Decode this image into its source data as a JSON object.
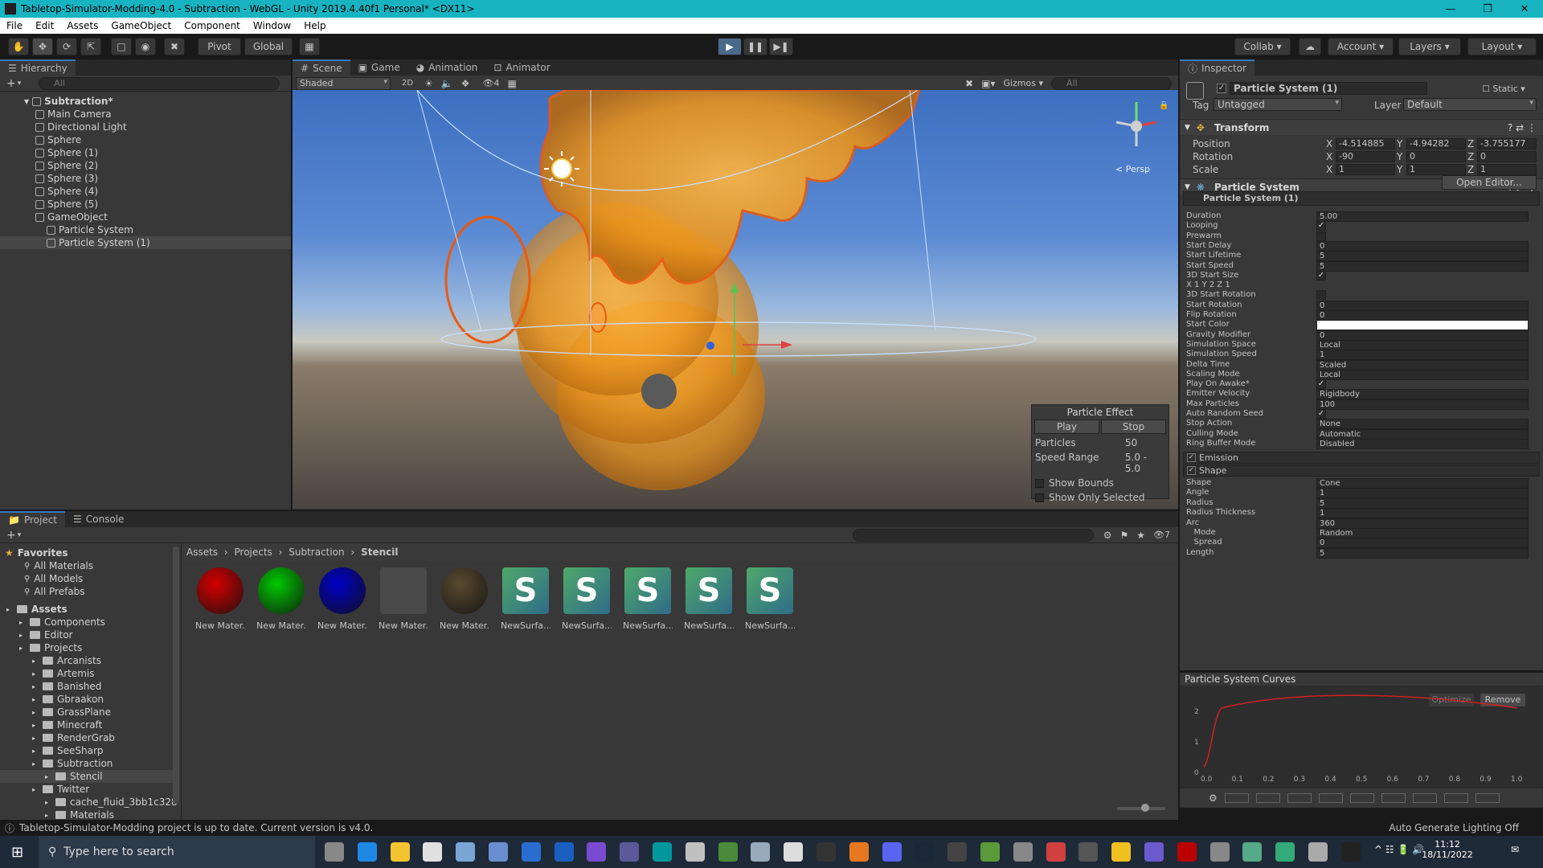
{
  "window": {
    "title": "Tabletop-Simulator-Modding-4.0 - Subtraction - WebGL - Unity 2019.4.40f1 Personal* <DX11>"
  },
  "menu": [
    "File",
    "Edit",
    "Assets",
    "GameObject",
    "Component",
    "Window",
    "Help"
  ],
  "toolbar": {
    "pivot": "Pivot",
    "global": "Global",
    "collab": "Collab",
    "account": "Account",
    "layers": "Layers",
    "layout": "Layout"
  },
  "hierarchy": {
    "tab": "Hierarchy",
    "search_placeholder": "All",
    "items": [
      {
        "label": "Subtraction*",
        "indent": 0
      },
      {
        "label": "Main Camera",
        "indent": 1
      },
      {
        "label": "Directional Light",
        "indent": 1
      },
      {
        "label": "Sphere",
        "indent": 1
      },
      {
        "label": "Sphere (1)",
        "indent": 1
      },
      {
        "label": "Sphere (2)",
        "indent": 1
      },
      {
        "label": "Sphere (3)",
        "indent": 1
      },
      {
        "label": "Sphere (4)",
        "indent": 1
      },
      {
        "label": "Sphere (5)",
        "indent": 1
      },
      {
        "label": "GameObject",
        "indent": 1
      },
      {
        "label": "Particle System",
        "indent": 2
      },
      {
        "label": "Particle System (1)",
        "indent": 2
      }
    ]
  },
  "scene": {
    "tabs": [
      "Scene",
      "Game",
      "Animation",
      "Animator"
    ],
    "shading": "Shaded",
    "mode2d": "2D",
    "gizmos": "Gizmos",
    "search_placeholder": "All",
    "layer_count": "4",
    "persp": "< Persp",
    "particle_effect": {
      "title": "Particle Effect",
      "play": "Play",
      "stop": "Stop",
      "particles_label": "Particles",
      "particles_value": "50",
      "speed_label": "Speed Range",
      "speed_value": "5.0 - 5.0",
      "show_bounds": "Show Bounds",
      "show_selected": "Show Only Selected"
    }
  },
  "inspector": {
    "tab": "Inspector",
    "object_name": "Particle System (1)",
    "static_label": "Static",
    "tag_label": "Tag",
    "tag_value": "Untagged",
    "layer_label": "Layer",
    "layer_value": "Default",
    "transform": {
      "title": "Transform",
      "rows": [
        {
          "label": "Position",
          "x": "-4.514885",
          "y": "-4.94282",
          "z": "-3.755177"
        },
        {
          "label": "Rotation",
          "x": "-90",
          "y": "0",
          "z": "0"
        },
        {
          "label": "Scale",
          "x": "1",
          "y": "1",
          "z": "1"
        }
      ]
    },
    "particle_system": {
      "title": "Particle System",
      "open_editor": "Open Editor...",
      "module_name": "Particle System (1)",
      "fields": [
        {
          "label": "Duration",
          "value": "5.00"
        },
        {
          "label": "Looping",
          "check": true
        },
        {
          "label": "Prewarm",
          "check": false
        },
        {
          "label": "Start Delay",
          "value": "0"
        },
        {
          "label": "Start Lifetime",
          "value": "5"
        },
        {
          "label": "Start Speed",
          "value": "5"
        },
        {
          "label": "3D Start Size",
          "check": true
        },
        {
          "label": "X 1      Y 2      Z 1",
          "value": ""
        },
        {
          "label": "3D Start Rotation",
          "check": false
        },
        {
          "label": "Start Rotation",
          "value": "0"
        },
        {
          "label": "Flip Rotation",
          "value": "0"
        },
        {
          "label": "Start Color",
          "value": "",
          "color": "#ffffff"
        },
        {
          "label": "Gravity Modifier",
          "value": "0"
        },
        {
          "label": "Simulation Space",
          "value": "Local"
        },
        {
          "label": "Simulation Speed",
          "value": "1"
        },
        {
          "label": "Delta Time",
          "value": "Scaled"
        },
        {
          "label": "Scaling Mode",
          "value": "Local"
        },
        {
          "label": "Play On Awake*",
          "check": true
        },
        {
          "label": "Emitter Velocity",
          "value": "Rigidbody"
        },
        {
          "label": "Max Particles",
          "value": "100"
        },
        {
          "label": "Auto Random Seed",
          "check": true
        },
        {
          "label": "Stop Action",
          "value": "None"
        },
        {
          "label": "Culling Mode",
          "value": "Automatic"
        },
        {
          "label": "Ring Buffer Mode",
          "value": "Disabled"
        }
      ],
      "modules": [
        "Emission",
        "Shape"
      ],
      "shape_fields": [
        {
          "label": "Shape",
          "value": "Cone"
        },
        {
          "label": "Angle",
          "value": "1"
        },
        {
          "label": "Radius",
          "value": "5"
        },
        {
          "label": "Radius Thickness",
          "value": "1"
        },
        {
          "label": "Arc",
          "value": "360"
        },
        {
          "label": "   Mode",
          "value": "Random"
        },
        {
          "label": "   Spread",
          "value": "0"
        },
        {
          "label": "Length",
          "value": "5"
        }
      ]
    },
    "curves": {
      "title": "Particle System Curves",
      "optimize": "Optimize",
      "remove": "Remove",
      "y_labels": [
        "2",
        "1",
        "0"
      ],
      "x_labels": [
        "0.0",
        "0.1",
        "0.2",
        "0.3",
        "0.4",
        "0.5",
        "0.6",
        "0.7",
        "0.8",
        "0.9",
        "1.0"
      ]
    }
  },
  "project": {
    "tabs": [
      "Project",
      "Console"
    ],
    "breadcrumb": [
      "Assets",
      "Projects",
      "Subtraction",
      "Stencil"
    ],
    "hidden_count": "7",
    "favorites": {
      "title": "Favorites",
      "items": [
        "All Materials",
        "All Models",
        "All Prefabs"
      ]
    },
    "tree": [
      {
        "label": "Assets",
        "indent": 0,
        "bold": true
      },
      {
        "label": "Components",
        "indent": 1
      },
      {
        "label": "Editor",
        "indent": 1
      },
      {
        "label": "Projects",
        "indent": 1
      },
      {
        "label": "Arcanists",
        "indent": 2
      },
      {
        "label": "Artemis",
        "indent": 2
      },
      {
        "label": "Banished",
        "indent": 2
      },
      {
        "label": "Gbraakon",
        "indent": 2
      },
      {
        "label": "GrassPlane",
        "indent": 2
      },
      {
        "label": "Minecraft",
        "indent": 2
      },
      {
        "label": "RenderGrab",
        "indent": 2
      },
      {
        "label": "SeeSharp",
        "indent": 2
      },
      {
        "label": "Subtraction",
        "indent": 2
      },
      {
        "label": "Stencil",
        "indent": 3
      },
      {
        "label": "Twitter",
        "indent": 2
      },
      {
        "label": "cache_fluid_3bb1c328",
        "indent": 3
      },
      {
        "label": "Materials",
        "indent": 3
      }
    ],
    "assets": [
      {
        "label": "New Mater...",
        "kind": "sphere",
        "color": "#d40000"
      },
      {
        "label": "New Mater...",
        "kind": "sphere",
        "color": "#00c800"
      },
      {
        "label": "New Mater...",
        "kind": "sphere",
        "color": "#0000c8"
      },
      {
        "label": "New Mater...",
        "kind": "flat",
        "color": "#4a4a4a"
      },
      {
        "label": "New Mater...",
        "kind": "sphere",
        "color": "#5a4a30"
      },
      {
        "label": "NewSurfa...",
        "kind": "shader",
        "color": "#3a8a6a"
      },
      {
        "label": "NewSurfa...",
        "kind": "shader",
        "color": "#3a8a6a"
      },
      {
        "label": "NewSurfa...",
        "kind": "shader",
        "color": "#3a8a6a"
      },
      {
        "label": "NewSurfa...",
        "kind": "shader",
        "color": "#3a8a6a"
      },
      {
        "label": "NewSurfa...",
        "kind": "shader",
        "color": "#3a8a6a"
      }
    ]
  },
  "status": {
    "message": "Tabletop-Simulator-Modding project is up to date. Current version is v4.0.",
    "right": "Auto Generate Lighting Off"
  },
  "taskbar": {
    "search_placeholder": "Type here to search",
    "time": "11:12",
    "date": "18/11/2022"
  }
}
